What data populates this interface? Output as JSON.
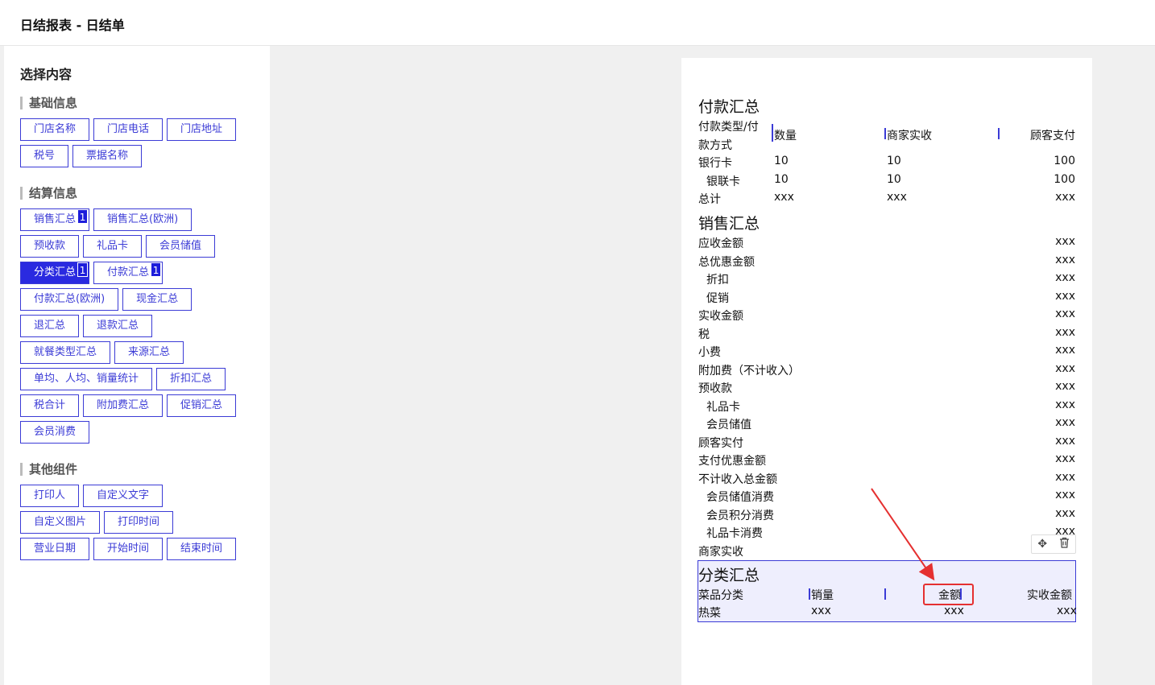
{
  "page_title": "日结报表 - 日结单",
  "sidebar": {
    "heading": "选择内容",
    "groups": [
      {
        "title": "基础信息",
        "rows": [
          [
            {
              "label": "门店名称"
            },
            {
              "label": "门店电话"
            },
            {
              "label": "门店地址"
            }
          ],
          [
            {
              "label": "税号"
            },
            {
              "label": "票据名称"
            }
          ]
        ]
      },
      {
        "title": "结算信息",
        "rows": [
          [
            {
              "label": "销售汇总",
              "badge": "1"
            },
            {
              "label": "销售汇总(欧洲)"
            }
          ],
          [
            {
              "label": "预收款"
            },
            {
              "label": "礼品卡"
            },
            {
              "label": "会员储值"
            }
          ],
          [
            {
              "label": "分类汇总",
              "badge": "1",
              "active": true
            },
            {
              "label": "付款汇总",
              "badge": "1"
            }
          ],
          [
            {
              "label": "付款汇总(欧洲)"
            },
            {
              "label": "现金汇总"
            }
          ],
          [
            {
              "label": "退汇总"
            },
            {
              "label": "退款汇总"
            }
          ],
          [
            {
              "label": "就餐类型汇总"
            },
            {
              "label": "来源汇总"
            }
          ],
          [
            {
              "label": "单均、人均、销量统计"
            },
            {
              "label": "折扣汇总"
            }
          ],
          [
            {
              "label": "税合计"
            },
            {
              "label": "附加费汇总"
            },
            {
              "label": "促销汇总"
            }
          ],
          [
            {
              "label": "会员消费"
            }
          ]
        ]
      },
      {
        "title": "其他组件",
        "rows": [
          [
            {
              "label": "打印人"
            },
            {
              "label": "自定义文字"
            }
          ],
          [
            {
              "label": "自定义图片"
            },
            {
              "label": "打印时间"
            }
          ],
          [
            {
              "label": "营业日期"
            },
            {
              "label": "开始时间"
            },
            {
              "label": "结束时间"
            }
          ]
        ]
      }
    ]
  },
  "receipt": {
    "payment": {
      "title": "付款汇总",
      "headers": [
        "付款类型/付",
        "款方式",
        "数量",
        "商家实收",
        "顾客支付"
      ],
      "rows": [
        {
          "name": "银行卡",
          "qty": "10",
          "merchant": "10",
          "customer": "100"
        },
        {
          "name": "银联卡",
          "qty": "10",
          "merchant": "10",
          "customer": "100"
        },
        {
          "name": "总计",
          "qty": "xxx",
          "merchant": "xxx",
          "customer": "xxx"
        }
      ]
    },
    "sales": {
      "title": "销售汇总",
      "rows": [
        {
          "label": "应收金额",
          "value": "xxx"
        },
        {
          "label": "总优惠金额",
          "value": "xxx"
        },
        {
          "label": "折扣",
          "value": "xxx"
        },
        {
          "label": "促销",
          "value": "xxx"
        },
        {
          "label": "实收金额",
          "value": "xxx"
        },
        {
          "label": "税",
          "value": "xxx"
        },
        {
          "label": "小费",
          "value": "xxx"
        },
        {
          "label": "附加费（不计收入）",
          "value": "xxx"
        },
        {
          "label": "预收款",
          "value": "xxx"
        },
        {
          "label": "礼品卡",
          "value": "xxx"
        },
        {
          "label": "会员储值",
          "value": "xxx"
        },
        {
          "label": "顾客实付",
          "value": "xxx"
        },
        {
          "label": "支付优惠金额",
          "value": "xxx"
        },
        {
          "label": "不计收入总金额",
          "value": "xxx"
        },
        {
          "label": "会员储值消费",
          "value": "xxx"
        },
        {
          "label": "会员积分消费",
          "value": "xxx"
        },
        {
          "label": "礼品卡消费",
          "value": "xxx"
        },
        {
          "label": "商家实收",
          "value": ""
        }
      ]
    },
    "category": {
      "title": "分类汇总",
      "headers": [
        "菜品分类",
        "销量",
        "金额",
        "实收金额"
      ],
      "row": {
        "name": "热菜",
        "qty": "xxx",
        "amount": "xxx",
        "actual": "xxx"
      }
    }
  },
  "toolbox": {
    "move_icon": "✥",
    "delete_icon": "🗑"
  },
  "colors": {
    "accent": "#3b3bd6",
    "active": "#2a2ae0",
    "highlight": "#e53030"
  }
}
